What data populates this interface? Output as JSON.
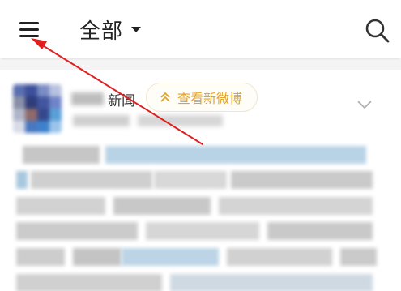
{
  "header": {
    "menu_icon": "hamburger-menu-icon",
    "title": "全部",
    "title_dropdown_icon": "caret-down-icon",
    "search_icon": "search-icon"
  },
  "post": {
    "source_label": "新闻",
    "new_posts_badge": {
      "icon": "double-chevron-up-icon",
      "label": "查看新微博"
    },
    "expand_icon": "chevron-down-icon",
    "content_blurred": true
  },
  "annotation": {
    "type": "arrow",
    "color": "#e02020",
    "points_to": "hamburger-menu-icon"
  },
  "colors": {
    "badge_text": "#e2a428",
    "title_text": "#222222",
    "annotation_red": "#e02020"
  }
}
